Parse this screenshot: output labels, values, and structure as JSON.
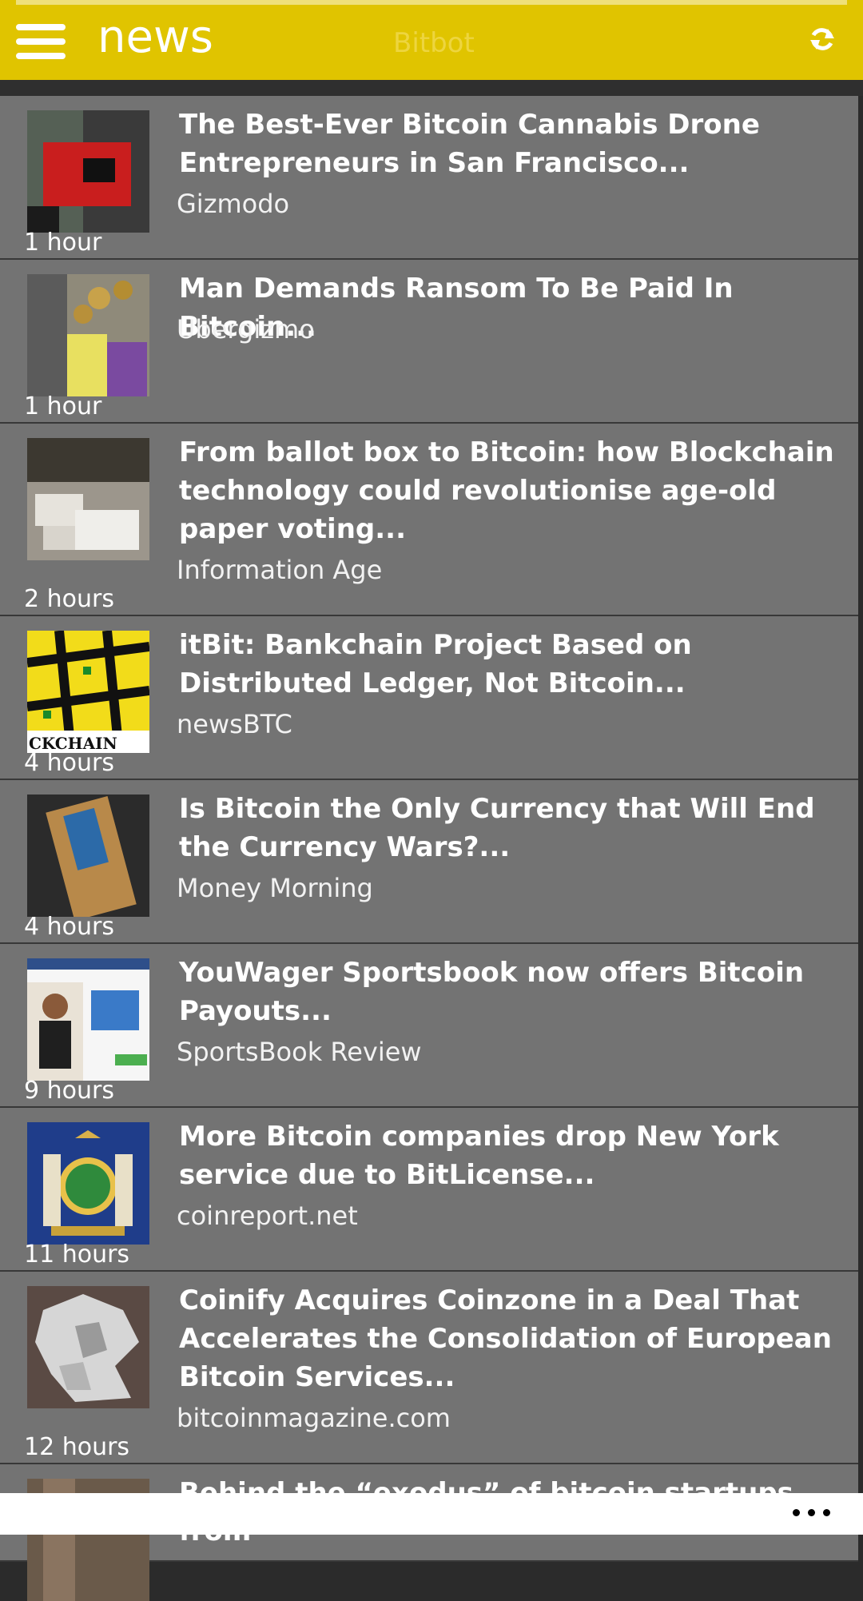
{
  "header": {
    "title": "news",
    "watermark": "Bitbot"
  },
  "articles": [
    {
      "title": "The Best-Ever Bitcoin Cannabis Drone Entrepreneurs in San Francisco...",
      "source": "Gizmodo",
      "time": "1 hour"
    },
    {
      "title": "Man Demands Ransom To Be Paid In Bitcoin...",
      "source": "Ubergizmo",
      "time": "1 hour"
    },
    {
      "title": "From ballot box to Bitcoin: how Blockchain technology could revolutionise age-old paper voting...",
      "source": "Information Age",
      "time": "2 hours"
    },
    {
      "title": "itBit: Bankchain Project Based on Distributed Ledger, Not Bitcoin...",
      "source": "newsBTC",
      "time": "4 hours",
      "thumb_text": "CKCHAIN"
    },
    {
      "title": "Is Bitcoin the Only Currency that Will End the Currency Wars?...",
      "source": "Money Morning",
      "time": "4 hours"
    },
    {
      "title": "YouWager Sportsbook now offers Bitcoin Payouts...",
      "source": "SportsBook Review",
      "time": "9 hours"
    },
    {
      "title": "More Bitcoin companies drop New York service due to BitLicense...",
      "source": "coinreport.net",
      "time": "11 hours"
    },
    {
      "title": "Coinify Acquires Coinzone in a Deal That Accelerates the Consolidation of European Bitcoin Services...",
      "source": "bitcoinmagazine.com",
      "time": "12 hours"
    },
    {
      "title": "Behind the “exodus” of bitcoin startups from",
      "source": "",
      "time": ""
    }
  ]
}
